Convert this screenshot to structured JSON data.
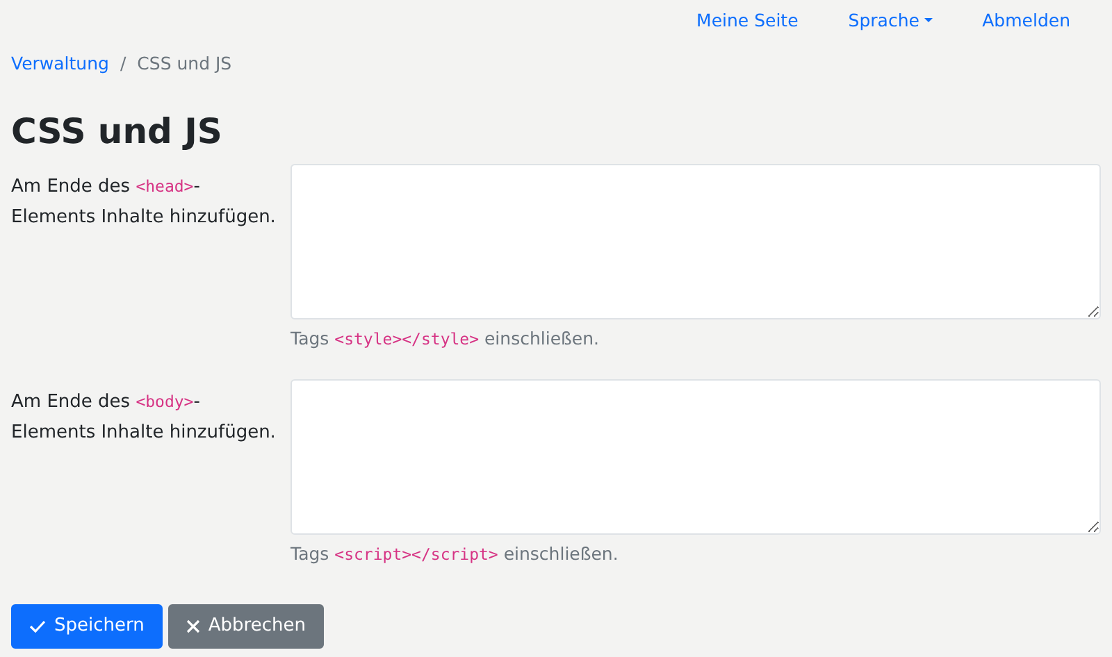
{
  "nav": [
    {
      "label": "Meine Seite",
      "kind": "link"
    },
    {
      "label": "Sprache",
      "kind": "dropdown"
    },
    {
      "label": "Abmelden",
      "kind": "link"
    }
  ],
  "breadcrumb": [
    {
      "label": "Verwaltung",
      "kind": "link"
    },
    {
      "label": "/",
      "kind": "separator"
    },
    {
      "label": "CSS und JS",
      "kind": "current"
    }
  ],
  "title": "CSS und JS",
  "fields": [
    {
      "label_lines": [
        [
          {
            "kind": "text",
            "text": "Am Ende des "
          },
          {
            "kind": "code",
            "text": "<head>"
          },
          {
            "kind": "text",
            "text": "-"
          }
        ],
        [
          {
            "kind": "text",
            "text": "Elements Inhalte hinzufügen."
          }
        ]
      ],
      "help": [
        {
          "kind": "text",
          "text": "Tags "
        },
        {
          "kind": "code",
          "text": "<style></style>"
        },
        {
          "kind": "text",
          "text": " einschließen."
        }
      ]
    },
    {
      "label_lines": [
        [
          {
            "kind": "text",
            "text": "Am Ende des "
          },
          {
            "kind": "code",
            "text": "<body>"
          },
          {
            "kind": "text",
            "text": "-"
          }
        ],
        [
          {
            "kind": "text",
            "text": "Elements Inhalte hinzufügen."
          }
        ]
      ],
      "help": [
        {
          "kind": "text",
          "text": "Tags "
        },
        {
          "kind": "code",
          "text": "<script></script>"
        },
        {
          "kind": "text",
          "text": " einschließen."
        }
      ]
    }
  ],
  "buttons": [
    {
      "label": "Speichern",
      "kind": "primary"
    },
    {
      "label": "Abbrechen",
      "kind": "secondary"
    }
  ]
}
